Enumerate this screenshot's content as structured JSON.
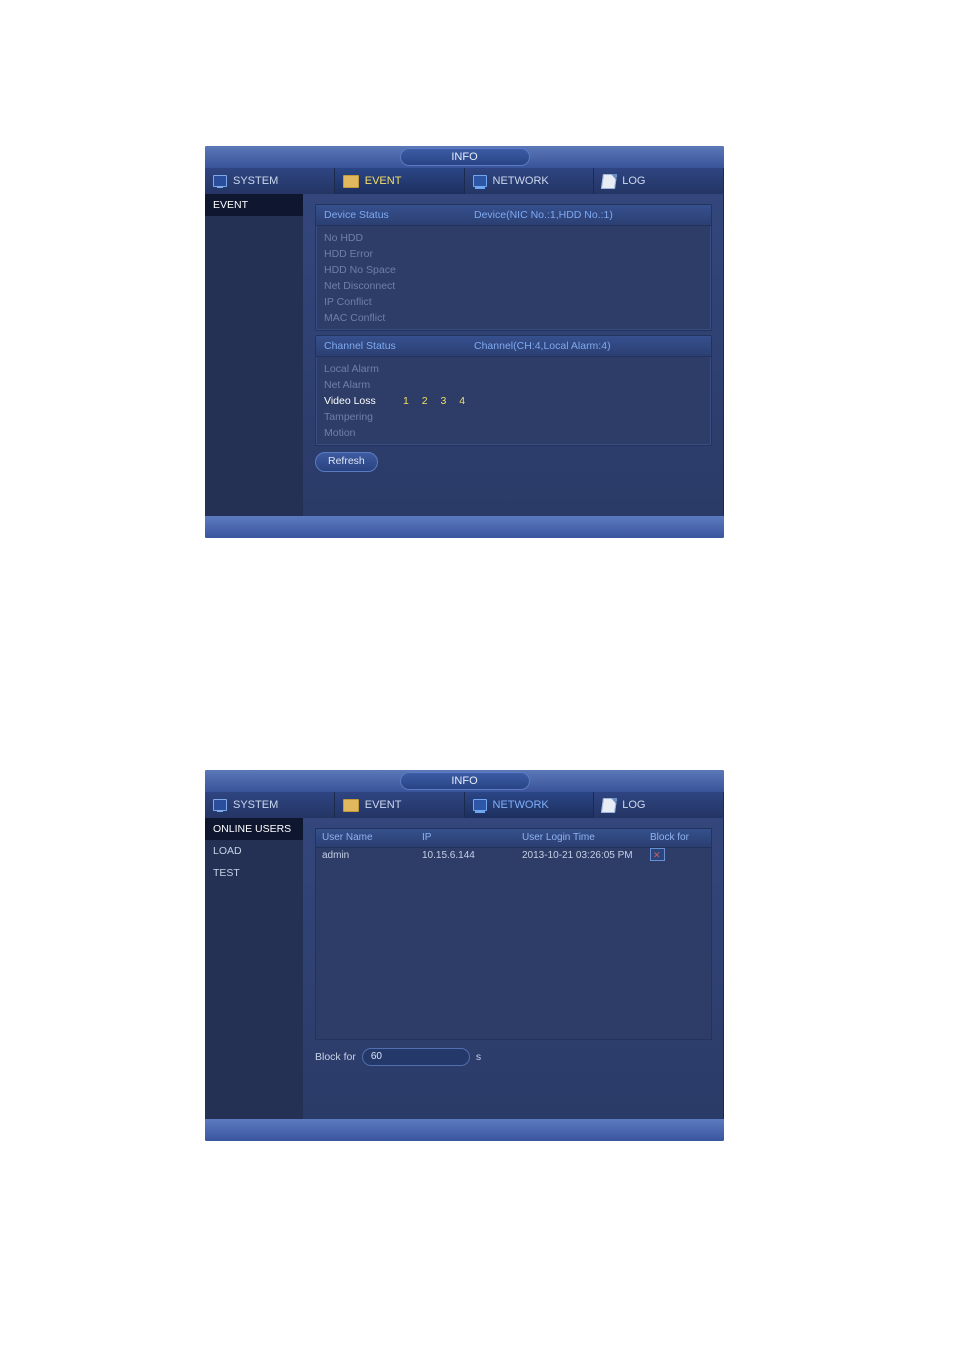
{
  "window_title": "INFO",
  "tabs": [
    {
      "label": "SYSTEM"
    },
    {
      "label": "EVENT"
    },
    {
      "label": "NETWORK"
    },
    {
      "label": "LOG"
    }
  ],
  "panel1": {
    "active_tab": "EVENT",
    "sidebar": [
      {
        "label": "EVENT",
        "selected": true
      }
    ],
    "device_status": {
      "header_left": "Device Status",
      "header_right": "Device(NIC No.:1,HDD No.:1)",
      "rows": [
        {
          "label": "No HDD"
        },
        {
          "label": "HDD Error"
        },
        {
          "label": "HDD No Space"
        },
        {
          "label": "Net Disconnect"
        },
        {
          "label": "IP Conflict"
        },
        {
          "label": "MAC Conflict"
        }
      ]
    },
    "channel_status": {
      "header_left": "Channel Status",
      "header_right": "Channel(CH:4,Local Alarm:4)",
      "rows": [
        {
          "label": "Local Alarm"
        },
        {
          "label": "Net Alarm"
        },
        {
          "label": "Video Loss",
          "channels": "1  2  3  4",
          "highlight": true
        },
        {
          "label": "Tampering"
        },
        {
          "label": "Motion"
        }
      ]
    },
    "refresh_label": "Refresh"
  },
  "panel2": {
    "active_tab": "NETWORK",
    "sidebar": [
      {
        "label": "ONLINE USERS",
        "selected": true
      },
      {
        "label": "LOAD"
      },
      {
        "label": "TEST"
      }
    ],
    "table": {
      "columns": {
        "user": "User Name",
        "ip": "IP",
        "time": "User Login Time",
        "block": "Block for"
      },
      "rows": [
        {
          "user": "admin",
          "ip": "10.15.6.144",
          "time": "2013-10-21 03:26:05 PM"
        }
      ]
    },
    "block_label": "Block for",
    "block_value": "60",
    "block_unit": "s"
  }
}
